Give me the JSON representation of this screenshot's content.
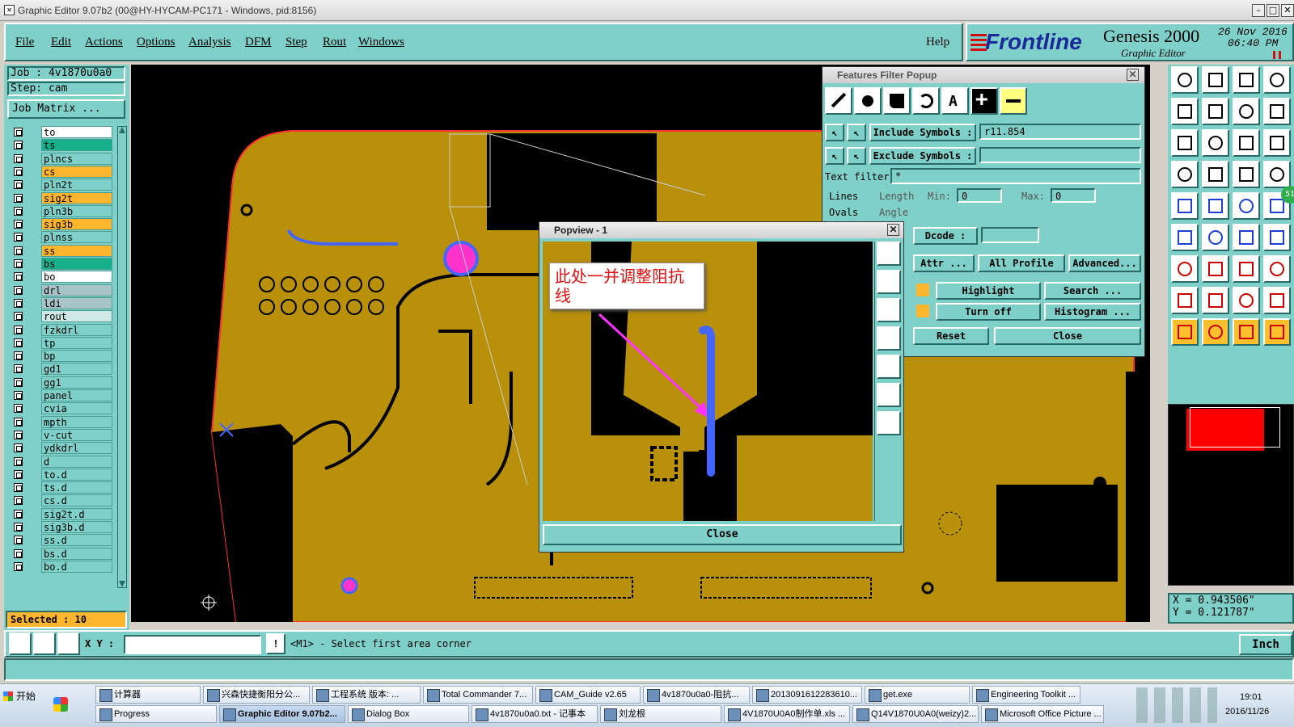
{
  "window": {
    "title": "Graphic Editor 9.07b2 (00@HY-HYCAM-PC171 - Windows, pid:8156)"
  },
  "menu": [
    "File",
    "Edit",
    "Actions",
    "Options",
    "Analysis",
    "DFM",
    "Step",
    "Rout",
    "Windows"
  ],
  "help": "Help",
  "brand": {
    "logo": "Frontline",
    "product": "Genesis 2000",
    "subtitle": "Graphic Editor",
    "date": "26 Nov 2016",
    "time": "06:40 PM"
  },
  "job": {
    "job_label": "Job : 4v1870u0a0",
    "step_label": "Step: cam",
    "matrix_button": "Job Matrix ..."
  },
  "layers": [
    {
      "name": "to",
      "color": "#ffffff"
    },
    {
      "name": "ts",
      "color": "#16b08a"
    },
    {
      "name": "plncs",
      "color": "#7fd0c8"
    },
    {
      "name": "cs",
      "color": "#ffb52e"
    },
    {
      "name": "pln2t",
      "color": "#7fd0c8"
    },
    {
      "name": "sig2t",
      "color": "#ffb52e"
    },
    {
      "name": "pln3b",
      "color": "#7fd0c8"
    },
    {
      "name": "sig3b",
      "color": "#ffb52e"
    },
    {
      "name": "plnss",
      "color": "#7fd0c8"
    },
    {
      "name": "ss",
      "color": "#ffb52e"
    },
    {
      "name": "bs",
      "color": "#16b08a"
    },
    {
      "name": "bo",
      "color": "#ffffff"
    },
    {
      "name": "drl",
      "color": "#a9c4c8"
    },
    {
      "name": "ldi",
      "color": "#a9c4c8"
    },
    {
      "name": "rout",
      "color": "#cfe7e5"
    },
    {
      "name": "fzkdrl",
      "color": "#7fd0c8"
    },
    {
      "name": "tp",
      "color": "#7fd0c8"
    },
    {
      "name": "bp",
      "color": "#7fd0c8"
    },
    {
      "name": "gd1",
      "color": "#7fd0c8"
    },
    {
      "name": "gg1",
      "color": "#7fd0c8"
    },
    {
      "name": "panel",
      "color": "#7fd0c8"
    },
    {
      "name": "cvia",
      "color": "#7fd0c8"
    },
    {
      "name": "mpth",
      "color": "#7fd0c8"
    },
    {
      "name": "v-cut",
      "color": "#7fd0c8"
    },
    {
      "name": "ydkdrl",
      "color": "#7fd0c8"
    },
    {
      "name": "d",
      "color": "#7fd0c8"
    },
    {
      "name": "to.d",
      "color": "#7fd0c8"
    },
    {
      "name": "ts.d",
      "color": "#7fd0c8"
    },
    {
      "name": "cs.d",
      "color": "#7fd0c8"
    },
    {
      "name": "sig2t.d",
      "color": "#7fd0c8"
    },
    {
      "name": "sig3b.d",
      "color": "#7fd0c8"
    },
    {
      "name": "ss.d",
      "color": "#7fd0c8"
    },
    {
      "name": "bs.d",
      "color": "#7fd0c8"
    },
    {
      "name": "bo.d",
      "color": "#7fd0c8"
    }
  ],
  "selected": "Selected : 10",
  "filter_popup": {
    "title": "Features Filter Popup",
    "include_label": "Include Symbols :",
    "include_value": "r11.854",
    "exclude_label": "Exclude Symbols :",
    "exclude_value": "",
    "text_filter_label": "Text filter",
    "text_filter_value": "*",
    "lines": "Lines",
    "ovals": "Ovals",
    "length": "Length",
    "angle": "Angle",
    "min": "Min:",
    "max": "Max:",
    "min_val": "0",
    "max_val": "0",
    "dcode": "Dcode :",
    "attr": "Attr ...",
    "all_profile": "All Profile",
    "advanced": "Advanced...",
    "highlight": "Highlight",
    "search": "Search ...",
    "turn_off": "Turn off",
    "histogram": "Histogram ...",
    "reset": "Reset",
    "close": "Close"
  },
  "popview": {
    "title": "Popview - 1",
    "annotation": "此处一并调整阻抗线",
    "close": "Close"
  },
  "tool_badge": "51",
  "coords": {
    "x": "X = 0.943506\"",
    "y": "Y = 0.121787\""
  },
  "command": {
    "xy_label": "X Y :",
    "xy_value": "",
    "prompt": "<M1> - Select first area corner",
    "units": "Inch"
  },
  "taskbar": {
    "start": "开始",
    "row1": [
      "计算器",
      "兴森快捷衡阳分公...",
      "工程系统  版本: ...",
      "Total Commander 7...",
      "CAM_Guide v2.65",
      "4v1870u0a0-阻抗...",
      "2013091612283610...",
      "get.exe",
      "Engineering Toolkit ..."
    ],
    "row2": [
      "Progress",
      "Graphic Editor 9.07b2...",
      "Dialog Box",
      "4v1870u0a0.txt - 记事本",
      "刘龙根",
      "4V1870U0A0制作单.xls ...",
      "Q14V1870U0A0(weizy)2...",
      "Microsoft Office Picture ..."
    ],
    "clock_time": "19:01",
    "clock_date": "2016/11/26"
  },
  "colors": {
    "panel": "#7fd0c8",
    "copper": "#b8900a",
    "pad": "#ff33cc",
    "trace": "#4466ff"
  }
}
